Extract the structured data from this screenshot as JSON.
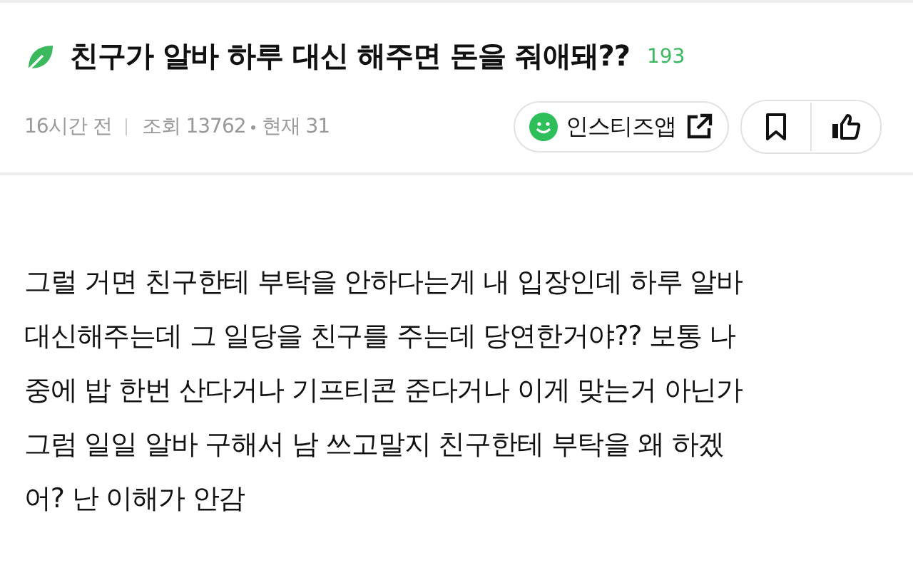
{
  "post": {
    "title": "친구가 알바 하루 대신 해주면 돈을 줘애돼??",
    "comment_count": "193",
    "time": "16시간 전",
    "views": "조회 13762",
    "current": "현재 31",
    "app_button": "인스티즈앱",
    "body_lines": [
      "그럴 거면 친구한테 부탁을 안하다는게 내 입장인데 하루 알바",
      "대신해주는데 그 일당을 친구를 주는데 당연한거야?? 보통 나",
      "중에 밥 한번 산다거나 기프티콘 준다거나 이게 맞는거 아닌가",
      "그럼 일일 알바 구해서 남 쓰고말지 친구한테 부탁을 왜 하겠",
      "어? 난 이해가 안감"
    ]
  }
}
